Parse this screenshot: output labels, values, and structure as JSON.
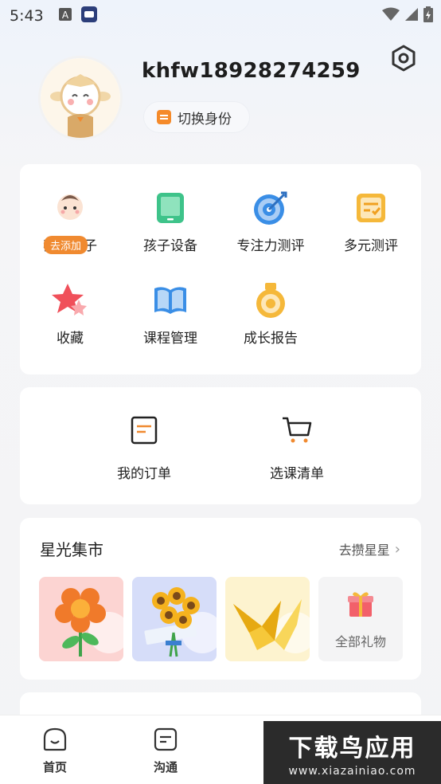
{
  "status_bar": {
    "time": "5:43"
  },
  "profile": {
    "username": "khfw18928274259",
    "switch_label": "切换身份"
  },
  "menu": {
    "items": [
      {
        "label": "我的孩子",
        "badge": "去添加"
      },
      {
        "label": "孩子设备"
      },
      {
        "label": "专注力测评"
      },
      {
        "label": "多元测评"
      },
      {
        "label": "收藏"
      },
      {
        "label": "课程管理"
      },
      {
        "label": "成长报告"
      }
    ]
  },
  "orders": {
    "items": [
      {
        "label": "我的订单"
      },
      {
        "label": "选课清单"
      }
    ]
  },
  "market": {
    "title": "星光集市",
    "more": "去攒星星",
    "all_gifts": "全部礼物"
  },
  "tabbar": {
    "items": [
      {
        "label": "首页"
      },
      {
        "label": "沟通"
      }
    ]
  },
  "watermark": {
    "title": "下载鸟应用",
    "url": "www.xiazainiao.com"
  },
  "colors": {
    "accent_orange": "#f08a30",
    "green": "#3ec38a",
    "blue": "#3a8ee6",
    "yellow": "#f5b83a",
    "red": "#f0505a"
  }
}
